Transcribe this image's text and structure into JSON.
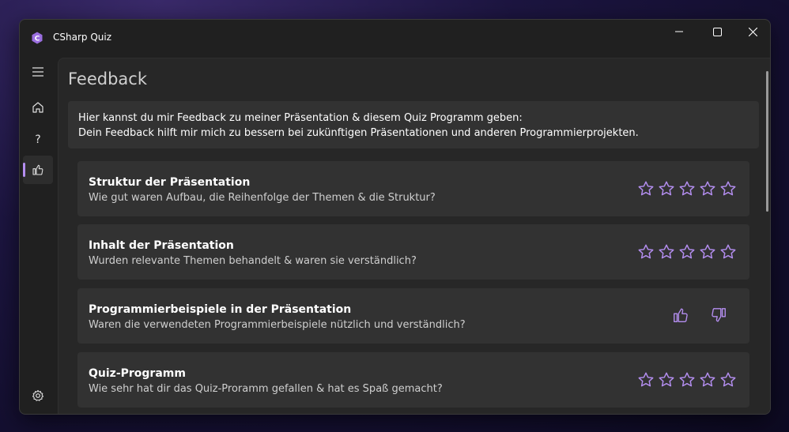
{
  "window": {
    "title": "CSharp Quiz"
  },
  "colors": {
    "accent": "#b48ef0",
    "card": "#323232",
    "background": "#272727"
  },
  "nav": {
    "items": [
      {
        "name": "menu",
        "icon": "hamburger-menu-icon"
      },
      {
        "name": "home",
        "icon": "home-icon"
      },
      {
        "name": "help",
        "icon": "question-mark-icon"
      },
      {
        "name": "feedback",
        "icon": "thumbs-up-icon",
        "selected": true
      }
    ],
    "footer": {
      "name": "settings",
      "icon": "gear-icon"
    }
  },
  "page": {
    "title": "Feedback",
    "intro_line1": "Hier kannst du mir Feedback zu meiner Präsentation & diesem Quiz Programm geben:",
    "intro_line2": "Dein Feedback hilft mir mich zu bessern bei zukünftigen Präsentationen und anderen Programmierprojekten."
  },
  "cards": [
    {
      "title": "Struktur der Präsentation",
      "subtitle": "Wie gut waren Aufbau, die Reihenfolge der Themen & die Struktur?",
      "control": "stars",
      "rating": 0,
      "max": 5
    },
    {
      "title": "Inhalt der Präsentation",
      "subtitle": "Wurden relevante Themen behandelt & waren sie verständlich?",
      "control": "stars",
      "rating": 0,
      "max": 5
    },
    {
      "title": "Programmierbeispiele in der Präsentation",
      "subtitle": "Waren die verwendeten Programmierbeispiele nützlich und verständlich?",
      "control": "thumbs"
    },
    {
      "title": "Quiz-Programm",
      "subtitle": "Wie sehr hat dir das Quiz-Proramm gefallen & hat es Spaß gemacht?",
      "control": "stars",
      "rating": 0,
      "max": 5
    }
  ]
}
